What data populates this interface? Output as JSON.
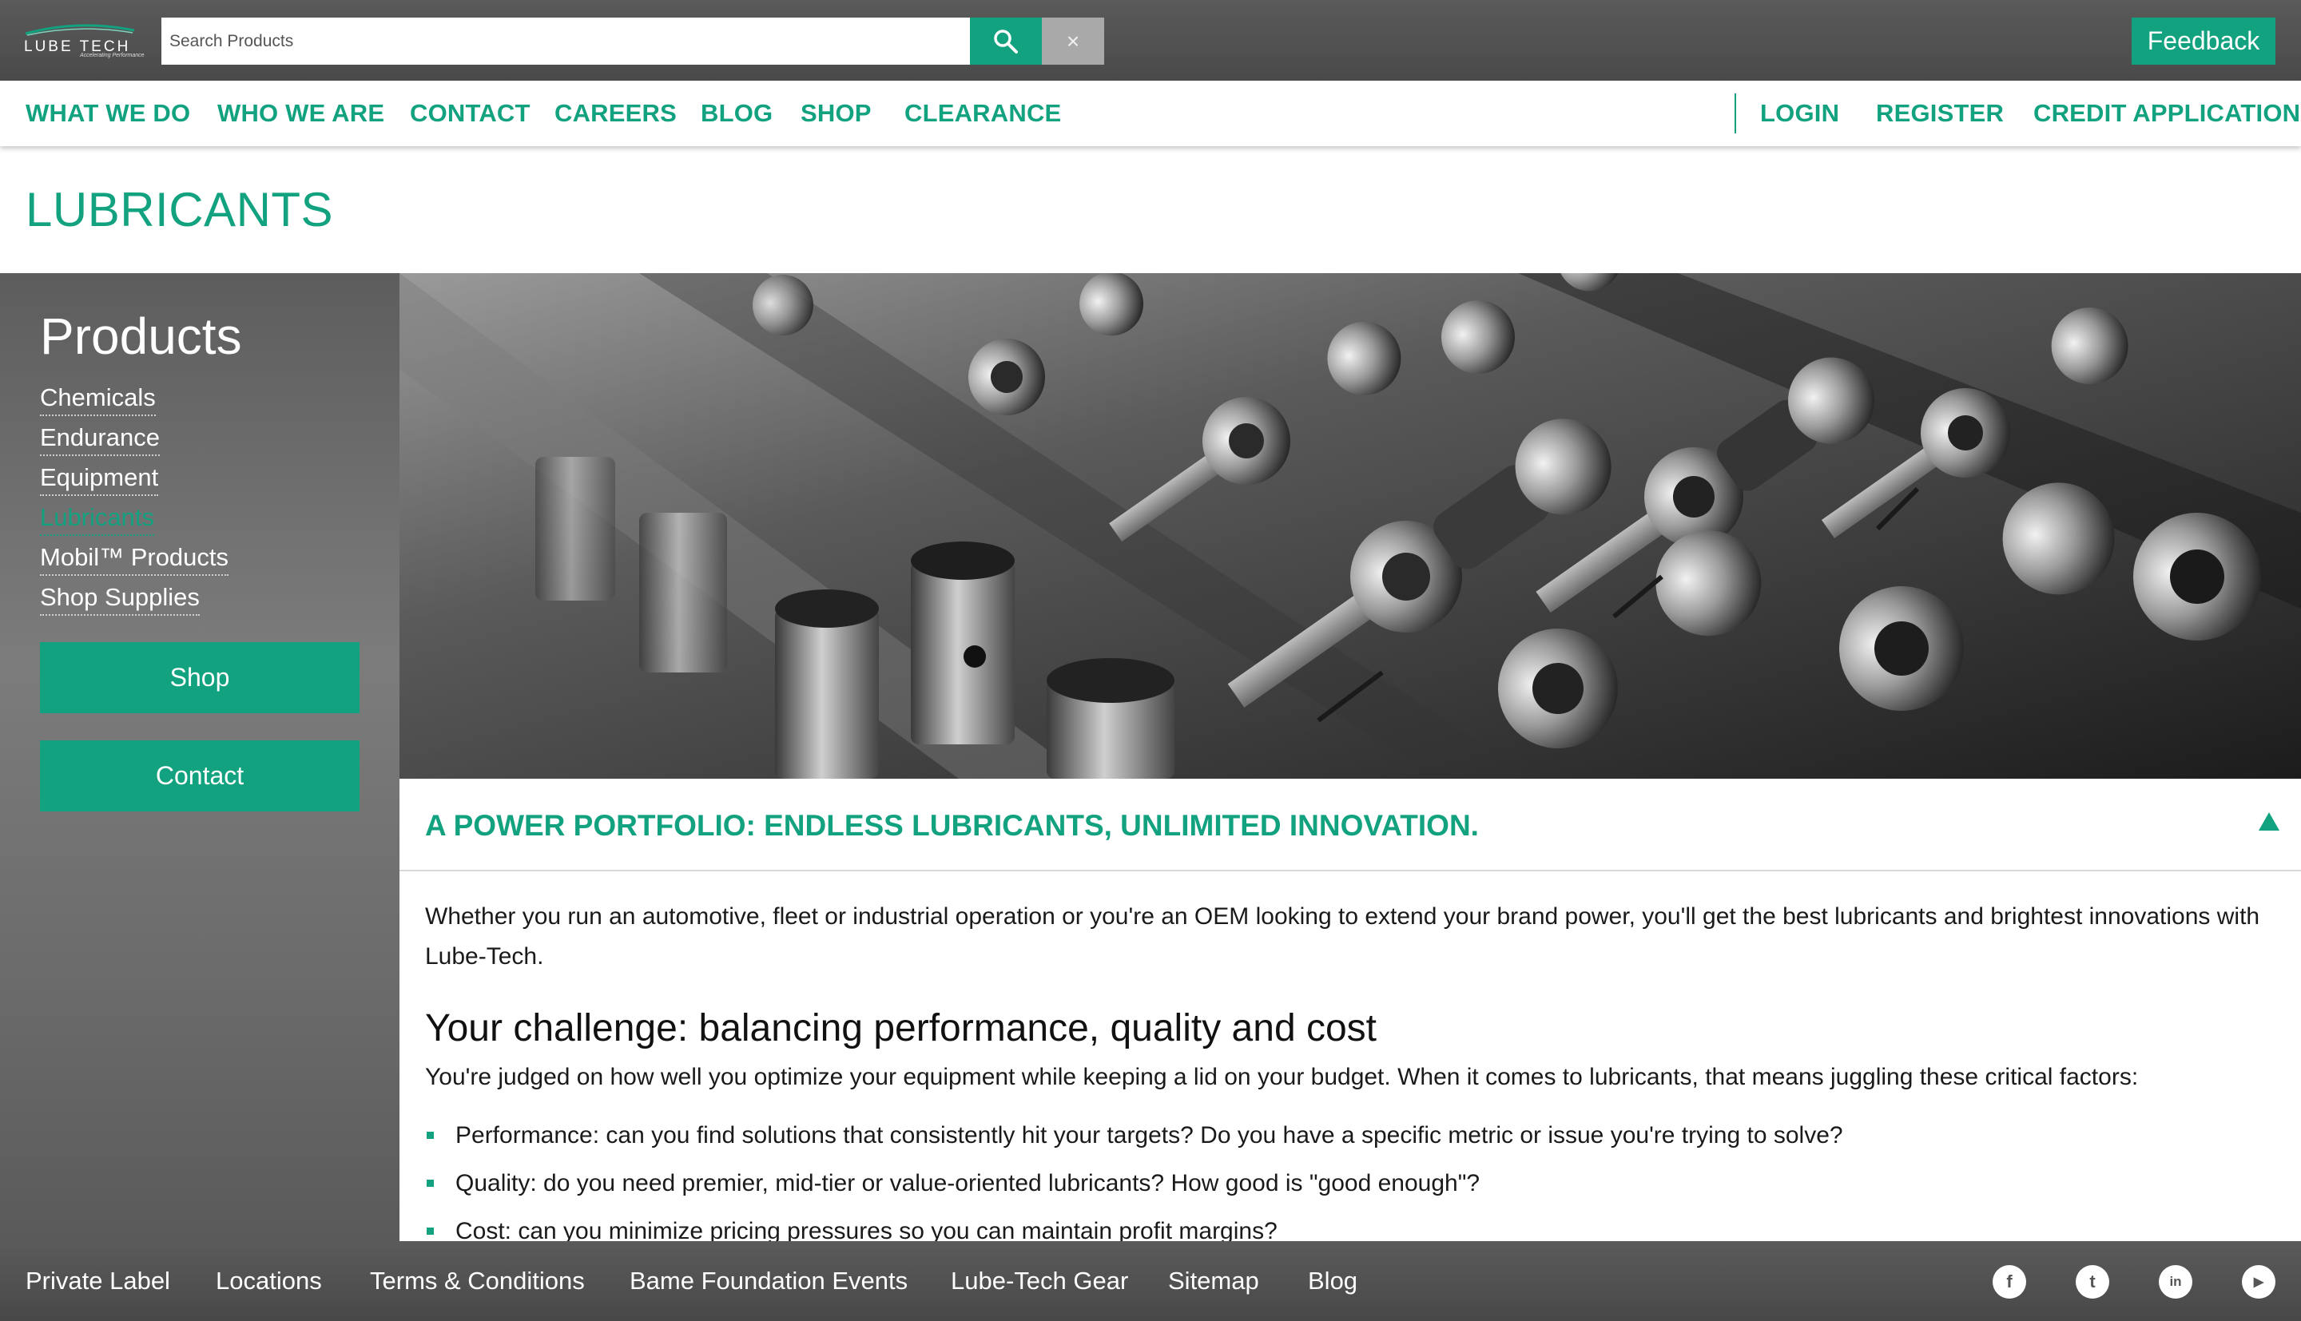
{
  "brand": {
    "name": "LUBE TECH",
    "tagline": "Accelerating Performance",
    "accent_color": "#12a27f"
  },
  "topbar": {
    "search_placeholder": "Search Products",
    "search_icon": "search-icon",
    "clear_label": "×",
    "feedback_label": "Feedback"
  },
  "nav": {
    "left": [
      "WHAT WE DO",
      "WHO WE ARE",
      "CONTACT",
      "CAREERS",
      "BLOG",
      "SHOP",
      "CLEARANCE"
    ],
    "right": [
      "LOGIN",
      "REGISTER",
      "CREDIT APPLICATION"
    ]
  },
  "page_title": "LUBRICANTS",
  "sidebar": {
    "title": "Products",
    "links": [
      "Chemicals",
      "Endurance",
      "Equipment",
      "Lubricants",
      "Mobil™ Products",
      "Shop Supplies"
    ],
    "active_link": "Lubricants",
    "buttons": [
      "Shop",
      "Contact"
    ]
  },
  "content": {
    "accordion_title": "A POWER PORTFOLIO: ENDLESS LUBRICANTS, UNLIMITED INNOVATION.",
    "collapse_icon": "triangle-up-icon",
    "intro": "Whether you run an automotive, fleet or industrial operation or you're an OEM looking to extend your brand power, you'll get the best lubricants and brightest innovations with Lube-Tech.",
    "challenge_heading": "Your challenge: balancing performance, quality and cost",
    "challenge_text": "You're judged on how well you optimize your equipment while keeping a lid on your budget. When it comes to lubricants, that means juggling these critical factors:",
    "bullets": [
      "Performance: can you find solutions that consistently hit your targets? Do you have a specific metric or issue you're trying to solve?",
      "Quality: do you need premier, mid-tier or value-oriented lubricants? How good is \"good enough\"?",
      "Cost: can you minimize pricing pressures so you can maintain profit margins?"
    ]
  },
  "footer": {
    "links": [
      "Private Label",
      "Locations",
      "Terms & Conditions",
      "Bame Foundation Events",
      "Lube-Tech Gear",
      "Sitemap",
      "Blog"
    ],
    "social": [
      {
        "icon": "facebook-icon",
        "glyph": "f"
      },
      {
        "icon": "twitter-icon",
        "glyph": "t"
      },
      {
        "icon": "linkedin-icon",
        "glyph": "in"
      },
      {
        "icon": "youtube-icon",
        "glyph": "▶"
      }
    ]
  }
}
